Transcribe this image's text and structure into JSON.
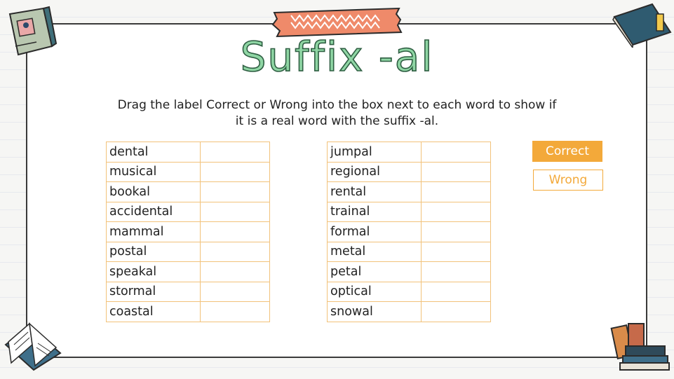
{
  "title": "Suffix -al",
  "instructions": {
    "line1": "Drag the label Correct or Wrong into the box next to each word to show if",
    "line2": "it is a real word with the suffix -al."
  },
  "left_words": [
    "dental",
    "musical",
    "bookal",
    "accidental",
    "mammal",
    "postal",
    "speakal",
    "stormal",
    "coastal"
  ],
  "right_words": [
    "jumpal",
    "regional",
    "rental",
    "trainal",
    "formal",
    "metal",
    "petal",
    "optical",
    "snowal"
  ],
  "labels": {
    "correct": "Correct",
    "wrong": "Wrong"
  },
  "colors": {
    "accent": "#f3a93a",
    "title_fill": "#8fd6a4",
    "table_border": "#f2c27a",
    "tape": "#ef8a6a"
  },
  "icons": [
    "book-top-left-icon",
    "book-top-right-icon",
    "open-book-bottom-left-icon",
    "book-stack-bottom-right-icon",
    "washi-tape-icon"
  ]
}
